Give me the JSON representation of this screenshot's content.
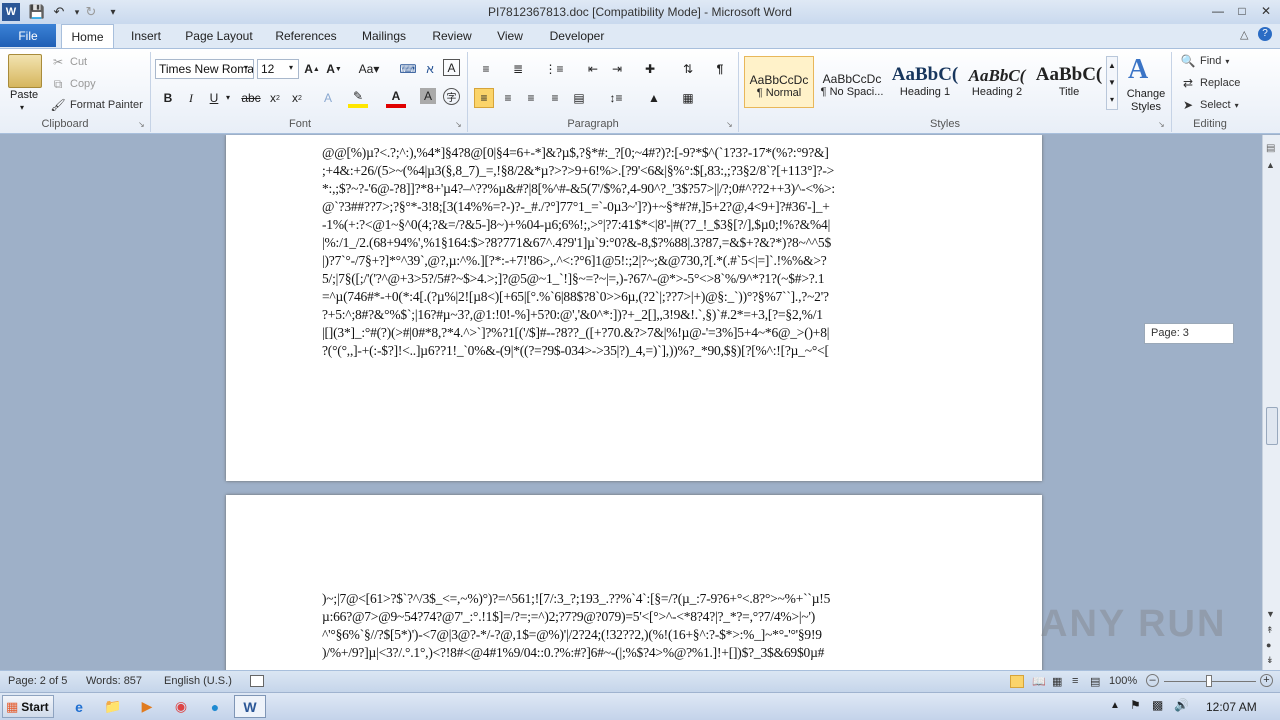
{
  "window": {
    "title": "PI7812367813.doc [Compatibility Mode] - Microsoft Word",
    "app_icon": "word-icon",
    "qat": [
      "save-icon",
      "undo-icon",
      "redo-icon",
      "customize-qat-icon"
    ],
    "controls": [
      "minimize-icon",
      "maximize-icon",
      "close-icon"
    ]
  },
  "tabs": [
    {
      "label": "File"
    },
    {
      "label": "Home"
    },
    {
      "label": "Insert"
    },
    {
      "label": "Page Layout"
    },
    {
      "label": "References"
    },
    {
      "label": "Mailings"
    },
    {
      "label": "Review"
    },
    {
      "label": "View"
    },
    {
      "label": "Developer"
    }
  ],
  "ribbon": {
    "clipboard": {
      "label": "Clipboard",
      "paste": "Paste",
      "cut": "Cut",
      "copy": "Copy",
      "format_painter": "Format Painter"
    },
    "font": {
      "label": "Font",
      "font_name": "Times New Roman",
      "font_size": "12"
    },
    "paragraph": {
      "label": "Paragraph"
    },
    "styles": {
      "label": "Styles",
      "items": [
        {
          "preview": "AaBbCcDc",
          "name": "¶ Normal"
        },
        {
          "preview": "AaBbCcDc",
          "name": "¶ No Spaci..."
        },
        {
          "preview": "AaBbC(",
          "name": "Heading 1"
        },
        {
          "preview": "AaBbC(",
          "name": "Heading 2"
        },
        {
          "preview": "AaBbC(",
          "name": "Title"
        }
      ],
      "change_styles": "Change Styles"
    },
    "editing": {
      "label": "Editing",
      "find": "Find",
      "replace": "Replace",
      "select": "Select"
    }
  },
  "document": {
    "page1_lines": [
      "@@[%)µ?<.?;^:),%4*]§4?8@[0|§4=6+-*]&?µ$,?§*#:_?[0;~4#?)?:[-9?*$^(`1?3?-17*(%?:°9?&]",
      ";+4&:+26/(5>~(%4|µ3(§,8_7)_=,!§8/2&*µ?>?>9+6!%>.[?9'<6&|§%°:$[,83:,;?3§2/8`?[+113°]?->",
      "*:,;$?~?-'6@-?8]]?*8+'µ4?–^??%µ&#?|8[%^#-&5(7'/$%?,4-90^?_'3$?57>||/?;0#^??2++3)^-<%>:",
      "@`?3##??7>;?§°*-3!8;[3(14%%=?-)?-_#./?°]77°1_=`-0µ3~']?)+~§*#?#,]5+2?@,4<9+]?#36'-]_+",
      "-1%(+:?<@1~§^0(4;?&=/?&5-]8~)+%04-µ6;6%!;,>°|?7:41$*<|8'-|#(?7_!_$3§[?/],$µ0;!%?&%4|",
      "|%:/1_/2.(68+94%',%1§164:$>?8?771&67^.4?9'1]µ`9:°0?&-8,$?%88|.3?87,=&$+?&?*)?8~^^5$",
      "|)?7`°-/7§+?]*°^39`,@?,µ:^%.][?*:-+7!'86>,.^<:?°6]1@5!:;2|?~;&@730,?[.*(.#`5<|=]`.!%%&>?",
      "5/;|7§([;/'('?^@+3>5?/5#?~$>4.>;]?@5@~1_`!]§~=?~|=,)-?67^-@*>-5°<>8`%/9^*?1?(~$#>?.1",
      "=^µ(746#*-+0(*:4[.(?µ%|2![µ8<)[+65|[°.%`6|88$?8`0>>6µ,(?2`|;??7>|+)@§:_`))°?§%7``].,?~2'?",
      "?+5:^;8#?&°%$`;|16?#µ~3?,@1:!0!-%]+5?0:@','&0^*:])?+_2[],,3!9&!.`,§)`#.2*=+3,[?=§2,%/1",
      "|[](3*]_:°#(?)(>#|0#*8,?*4.^>`]?%?1[('/$]#--?8??_([+?70.&?>7&|%!µ@-'=3%]5+4~*6@_>()+8|",
      "?(°(°,,]-+(:-$?]!<..]µ6??1!_`0%&-(9|*((?=?9$-034>->35|?)_4,=)`],))%?_*90,$§)[?[%^:![?µ_~°<["
    ],
    "page2_lines": [
      ")~;|7@<[61>?$`?^/3$_<=,~%)°)?=^561;![7/:3_?;193_.??%`4`:[§=/?(µ_:7-9?6+°<.8?°>~%+``µ!5",
      "µ:66?@7>@9~54?74?@7'_:°.!1$]=/?=;=^)2;?7?9@?079)=5'<[°>^-<*8?4?|?_*?=,°?7/4%>|~')",
      "^'°§6%`§//?$[5*)')-<7@|3@?-*/-?@,1$=@%)'|/2?24;(!32??2,)(%!(16+§^:?-$*>:%_]~*°-'°'§9!9",
      ")/%+/9?]µ|<3?/.°.1°,)<?!8#<@4#1%9/04::0.?%:#?]6#~-(|;%$?4>%@?%1.]!+[])$?_3$&69$0µ#"
    ]
  },
  "scroll_tip": "Page: 3",
  "status": {
    "page": "Page: 2 of 5",
    "words": "Words: 857",
    "language": "English (U.S.)",
    "zoom": "100%"
  },
  "taskbar": {
    "start": "Start",
    "apps": [
      "ie-icon",
      "explorer-icon",
      "media-player-icon",
      "chrome-icon",
      "edge-icon",
      "word-icon"
    ],
    "clock": "12:07 AM"
  },
  "watermark": "ANY RUN"
}
